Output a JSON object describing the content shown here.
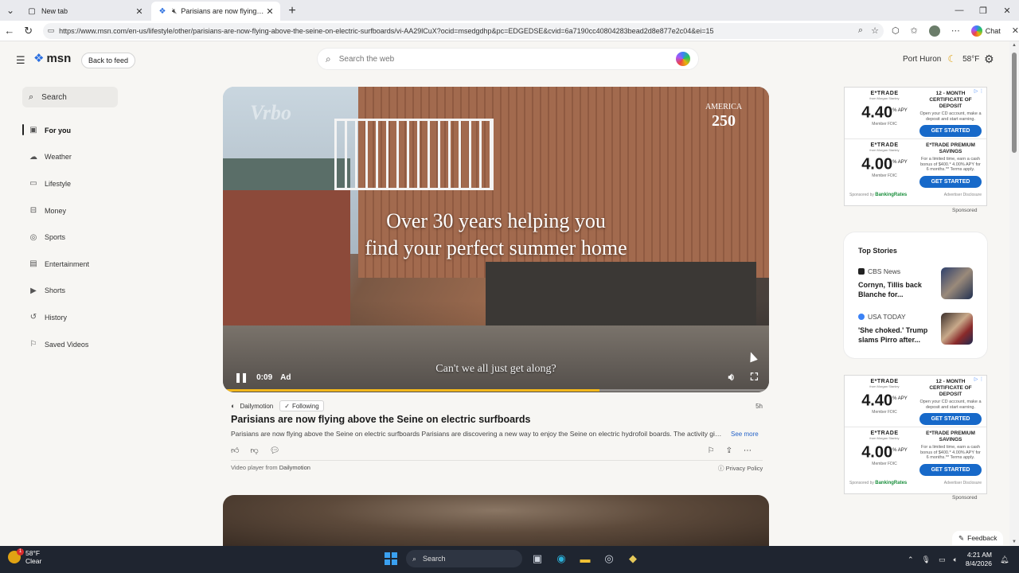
{
  "browser": {
    "tabs": [
      {
        "label": "New tab",
        "active": false
      },
      {
        "label": "Parisians are now flying above",
        "active": true
      }
    ],
    "url": "https://www.msn.com/en-us/lifestyle/other/parisians-are-now-flying-above-the-seine-on-electric-surfboards/vi-AA29lCuX?ocid=msedgdhp&pc=EDGEDSE&cvid=6a7190cc40804283bead2d8e877e2c04&ei=15",
    "chat_label": "Chat"
  },
  "header": {
    "logo_text": "msn",
    "back_label": "Back to feed",
    "search_placeholder": "Search the web",
    "location": "Port Huron",
    "temperature": "58°F"
  },
  "sidebar": {
    "search_label": "Search",
    "items": [
      {
        "label": "For you",
        "icon": "play-square-icon"
      },
      {
        "label": "Weather",
        "icon": "cloud-icon"
      },
      {
        "label": "Lifestyle",
        "icon": "couch-icon"
      },
      {
        "label": "Money",
        "icon": "money-icon"
      },
      {
        "label": "Sports",
        "icon": "ball-icon"
      },
      {
        "label": "Entertainment",
        "icon": "clapper-icon"
      },
      {
        "label": "Shorts",
        "icon": "play-icon"
      },
      {
        "label": "History",
        "icon": "history-icon"
      },
      {
        "label": "Saved Videos",
        "icon": "bookmark-icon"
      }
    ]
  },
  "video": {
    "caption_line1": "Over 30 years helping you",
    "caption_line2": "find your perfect summer home",
    "subtitle": "Can't we all just get along?",
    "brand_watermark": "Vrbo",
    "america_top": "AMERICA",
    "america_num": "250",
    "time": "0:09",
    "ad_label": "Ad",
    "progress_fraction": 0.69
  },
  "article": {
    "source": "Dailymotion",
    "following_label": "Following",
    "age": "5h",
    "title": "Parisians are now flying above the Seine on electric surfboards",
    "description": "Parisians are now flying above the Seine on electric surfboards Parisians are discovering a new way to enjoy the Seine on electric hydrofoil boards. The activity gives...",
    "see_more": "See more",
    "player_credit_prefix": "Video player from",
    "player_credit_source": "Dailymotion",
    "privacy_label": "Privacy Policy"
  },
  "ads": {
    "brand": "E*TRADE",
    "brand_sub": "from Morgan Stanley",
    "rate1": "4.40",
    "rate2": "4.00",
    "apy": "APY",
    "fdic": "Member FDIC",
    "head1": "12 - MONTH CERTIFICATE OF DEPOSIT",
    "copy1": "Open your CD account, make a deposit and start earning.",
    "head2": "E*TRADE PREMIUM SAVINGS",
    "copy2": "For a limited time, earn a cash bonus of $400.* 4.00% APY for 6 months.** Terms apply.",
    "cta": "GET STARTED",
    "sponsor_prefix": "Sponsored by",
    "sponsor_brand": "BankingRates",
    "disclosure": "Advertiser Disclosure",
    "sponsored_label": "Sponsored"
  },
  "top_stories": {
    "title": "Top Stories",
    "items": [
      {
        "publisher": "CBS News",
        "headline": "Cornyn, Tillis back Blanche for..."
      },
      {
        "publisher": "USA TODAY",
        "headline": "'She choked.' Trump slams Pirro after..."
      }
    ]
  },
  "feedback_label": "Feedback",
  "taskbar": {
    "weather_temp": "58°F",
    "weather_desc": "Clear",
    "badge": "1",
    "search_label": "Search",
    "time": "4:21 AM",
    "date": "8/4/2026"
  }
}
